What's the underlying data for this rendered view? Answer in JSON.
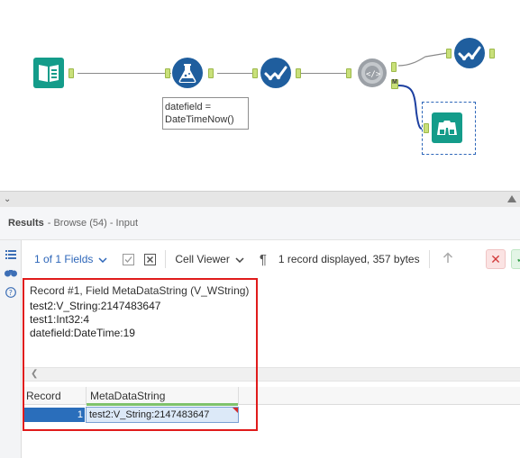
{
  "canvas": {
    "annotation": "datefield =\nDateTimeNow()",
    "anchor_m_label": "M"
  },
  "results": {
    "title": "Results",
    "subtitle": "- Browse (54) - Input"
  },
  "toolbar": {
    "fields_label": "1 of 1 Fields",
    "viewer_label": "Cell Viewer",
    "info": "1 record displayed, 357 bytes"
  },
  "record": {
    "title": "Record #1, Field MetaDataString (V_WString)",
    "lines": [
      "test2:V_String:2147483647",
      "test1:Int32:4",
      "datefield:DateTime:19"
    ]
  },
  "grid": {
    "headers": [
      "Record",
      "MetaDataString"
    ],
    "rows": [
      {
        "record": "1",
        "meta": "test2:V_String:2147483647"
      }
    ]
  },
  "colors": {
    "accent": "#2d66b9",
    "tool_blue": "#1f5e9e",
    "tool_purple": "#4b3b8e",
    "tool_teal": "#149c8a",
    "highlight": "#e01b1b"
  },
  "icons": [
    "book-icon",
    "formula-flask-icon",
    "check-icon",
    "regex-gear-icon",
    "binoculars-icon",
    "chevron-down-icon",
    "list-icon",
    "binoculars-icon",
    "help-icon",
    "checkbox-icon",
    "close-box-icon",
    "pilcrow-icon",
    "up-arrow-icon",
    "close-icon",
    "check-icon"
  ]
}
